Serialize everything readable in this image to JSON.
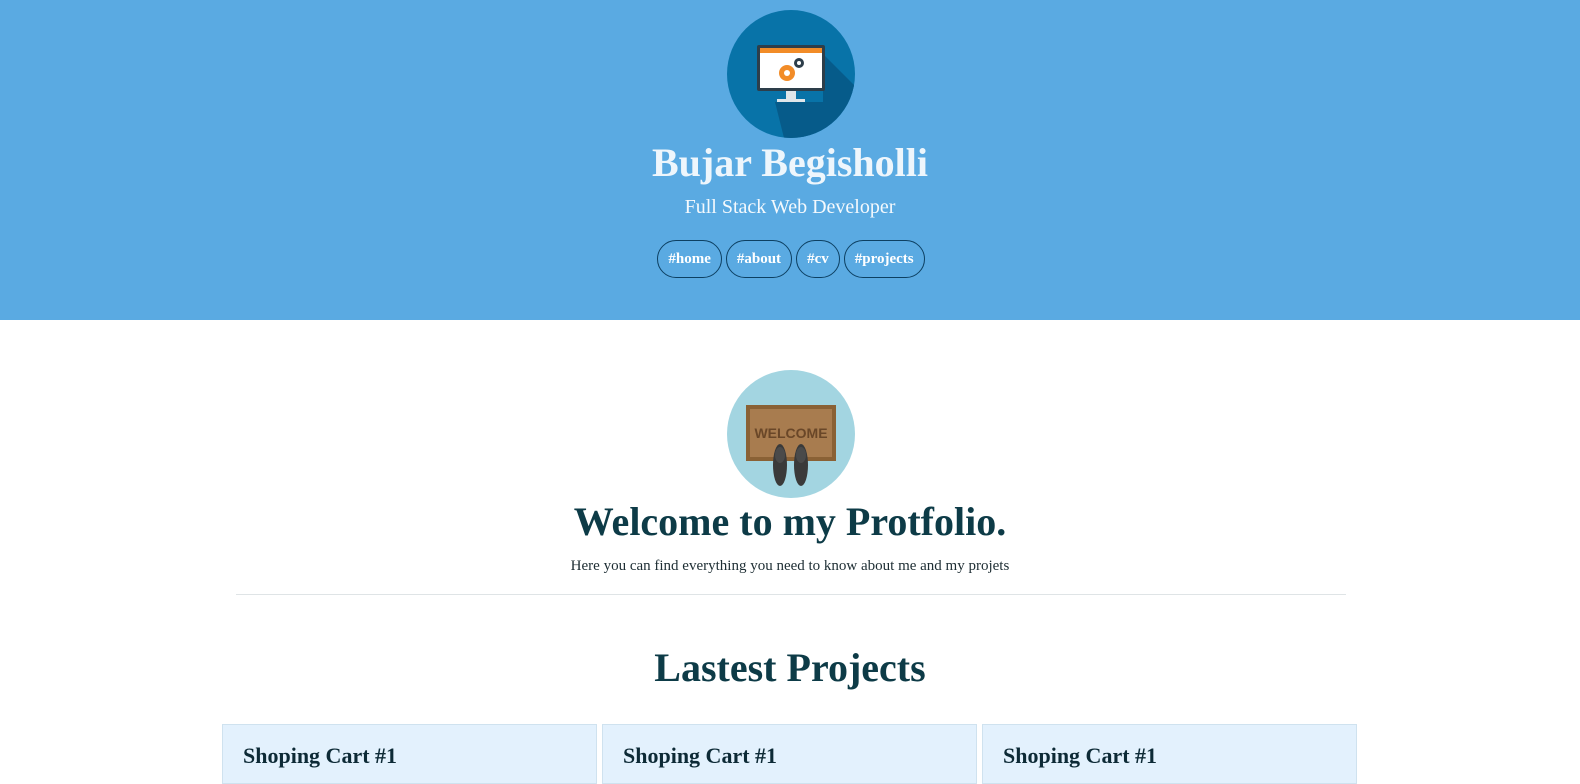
{
  "header": {
    "avatar_icon": "monitor-gear-icon",
    "name": "Bujar Begisholli",
    "role": "Full Stack Web Developer",
    "nav": [
      {
        "label": "#home"
      },
      {
        "label": "#about"
      },
      {
        "label": "#cv"
      },
      {
        "label": "#projects"
      }
    ],
    "bg_color": "#5aaae2"
  },
  "welcome": {
    "icon": "welcome-mat-icon",
    "mat_text": "WELCOME",
    "title": "Welcome to my Protfolio.",
    "subtitle": "Here you can find everything you need to know about me and my projets"
  },
  "projects": {
    "title": "Lastest Projects",
    "cards": [
      {
        "title": "Shoping Cart #1"
      },
      {
        "title": "Shoping Cart #1"
      },
      {
        "title": "Shoping Cart #1"
      }
    ]
  }
}
